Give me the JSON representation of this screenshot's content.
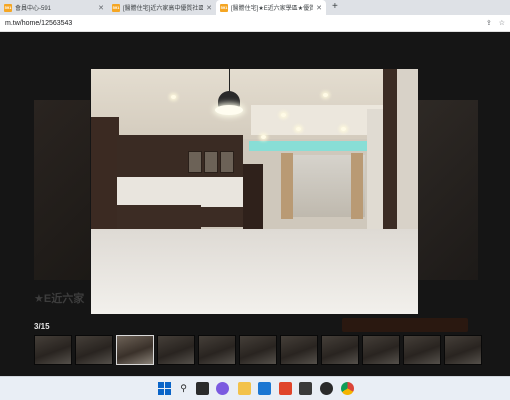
{
  "browser": {
    "tabs": [
      {
        "favicon_text": "591",
        "title": "會員中心-591"
      },
      {
        "favicon_text": "591",
        "title": "[醫謄住宅]近六家高中優質社區三"
      },
      {
        "favicon_text": "591",
        "title": "[醫謄住宅]★E近六家學區★優質"
      }
    ],
    "close_glyph": "✕",
    "new_tab_glyph": "+",
    "url": "m.tw/home/12563543"
  },
  "page": {
    "background_title": "★E近六家",
    "image_counter": "3/15"
  },
  "taskbar": {
    "icons": [
      "windows-start-icon",
      "search-icon",
      "task-view-icon",
      "chat-icon",
      "file-explorer-icon",
      "mail-icon",
      "office-icon",
      "store-icon",
      "dell-icon",
      "chrome-icon"
    ]
  },
  "colors": {
    "accent_favicon": "#f5a623",
    "cove_light": "#7fe0d8",
    "lightbox_bg": "#151515"
  }
}
